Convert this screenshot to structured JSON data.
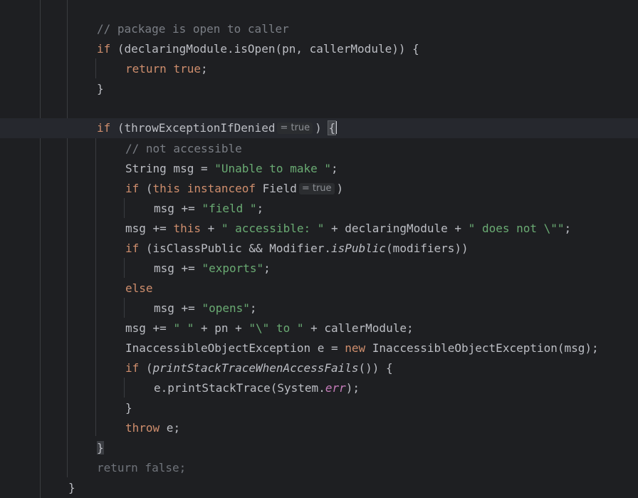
{
  "code": {
    "line1_comment": "// package is open to caller",
    "line2": {
      "kw": "if",
      "rest": " (declaringModule.isOpen(pn, callerModule)) {"
    },
    "line3": {
      "kw1": "return",
      "kw2": "true",
      "end": ";"
    },
    "line4": "}",
    "line6": {
      "kw": "if",
      "open": " (throwExceptionIfDenied",
      "hint": "= true",
      "close": ") ",
      "brace": "{"
    },
    "line7_comment": "// not accessible",
    "line8": {
      "pre": "String msg = ",
      "str": "\"Unable to make \"",
      "end": ";"
    },
    "line9": {
      "kw1": "if",
      "p1": " (",
      "kw2": "this",
      "sp": " ",
      "kw3": "instanceof",
      "p2": " Field",
      "hint": "= true",
      "close": ")"
    },
    "line10": {
      "pre": "msg += ",
      "str": "\"field \"",
      "end": ";"
    },
    "line11": {
      "pre": "msg += ",
      "kw": "this",
      "p1": " + ",
      "s1": "\" accessible: \"",
      "p2": " + declaringModule + ",
      "s2": "\" does not \\\"\"",
      "end": ";"
    },
    "line12": {
      "kw": "if",
      "p1": " (isClassPublic && Modifier.",
      "ital": "isPublic",
      "p2": "(modifiers))"
    },
    "line13": {
      "pre": "msg += ",
      "str": "\"exports\"",
      "end": ";"
    },
    "line14": "else",
    "line15": {
      "pre": "msg += ",
      "str": "\"opens\"",
      "end": ";"
    },
    "line16": {
      "pre": "msg += ",
      "s1": "\" \"",
      "p1": " + pn + ",
      "s2": "\"\\\" to \"",
      "p2": " + callerModule;"
    },
    "line17": {
      "pre": "InaccessibleObjectException e = ",
      "kw": "new",
      "post": " InaccessibleObjectException(msg);"
    },
    "line18": {
      "kw": "if",
      "p1": " (",
      "ital": "printStackTraceWhenAccessFails",
      "p2": "()) {"
    },
    "line19": {
      "pre": "e.printStackTrace(System.",
      "fld": "err",
      "end": ");"
    },
    "line20": "}",
    "line21": {
      "kw": "throw",
      "rest": " e;"
    },
    "line22": "}",
    "line23": "return false;",
    "line24": "}"
  },
  "colors": {
    "background": "#1e1f22",
    "keyword": "#cf8e6d",
    "string": "#6aab73",
    "comment": "#7a7e85",
    "field": "#c77dbb",
    "text": "#bcbec4"
  }
}
